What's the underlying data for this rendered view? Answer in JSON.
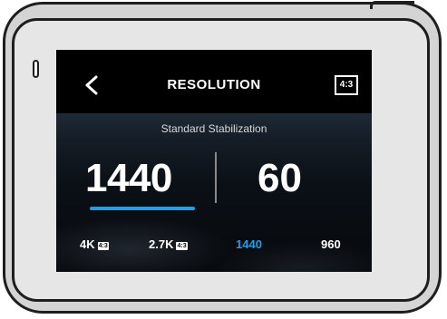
{
  "screen": {
    "title": "RESOLUTION",
    "aspect_button": "4:3",
    "stabilization": "Standard Stabilization",
    "selected_resolution": "1440",
    "selected_fps": "60",
    "resolution_options": [
      {
        "label": "4K",
        "badge": "4:3"
      },
      {
        "label": "2.7K",
        "badge": "4:3"
      },
      {
        "label": "1440",
        "badge": ""
      },
      {
        "label": "960",
        "badge": ""
      }
    ]
  },
  "colors": {
    "accent": "#1aa0ef",
    "screen_bg": "#000000",
    "device_body": "#d4d4d4"
  },
  "icons": {
    "back": "chevron-left-icon"
  }
}
